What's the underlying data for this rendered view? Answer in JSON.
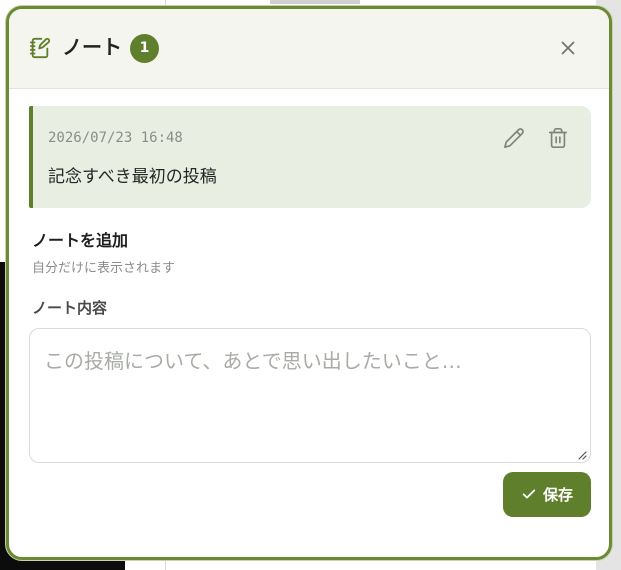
{
  "dialog": {
    "title": "ノート",
    "count": "1",
    "icon": "notebook-pen-icon",
    "close_icon": "close-icon"
  },
  "notes": [
    {
      "timestamp": "2026/07/23 16:48",
      "text": "記念すべき最初の投稿",
      "edit_icon": "pencil-icon",
      "delete_icon": "trash-icon"
    }
  ],
  "add_note": {
    "title": "ノートを追加",
    "hint": "自分だけに表示されます",
    "field_label": "ノート内容",
    "value": "",
    "placeholder": "この投稿について、あとで思い出したいこと…",
    "save_label": "保存",
    "save_icon": "check-icon"
  },
  "colors": {
    "accent": "#5f7f2c",
    "border": "#6a8a34",
    "card_bg": "#e9eee3",
    "header_bg": "#f3f5ee"
  }
}
